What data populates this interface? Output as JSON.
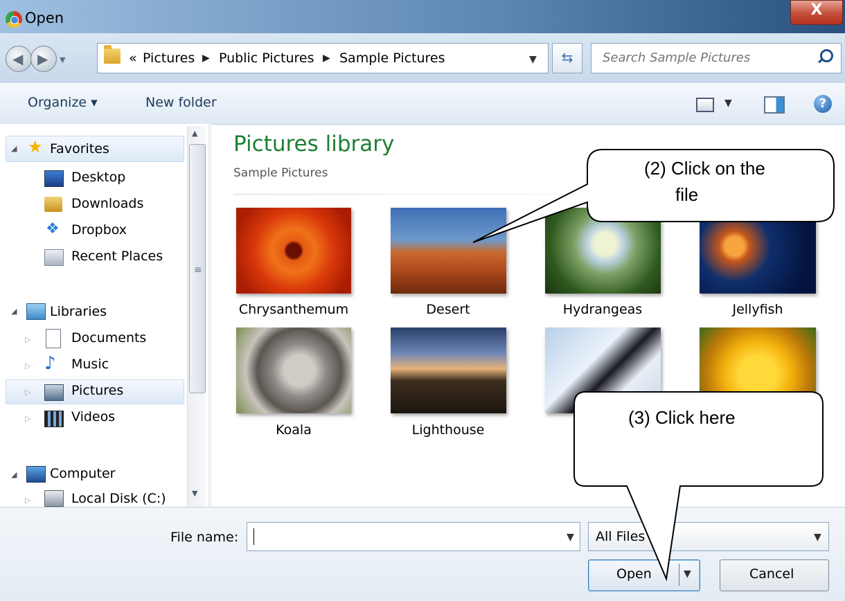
{
  "window": {
    "title": "Open",
    "close_label": "X"
  },
  "address": {
    "overflow": "«",
    "breadcrumbs": [
      "Pictures",
      "Public Pictures",
      "Sample Pictures"
    ],
    "separator": "▶",
    "search_placeholder": "Search Sample Pictures"
  },
  "toolbar": {
    "organize": "Organize ▾",
    "new_folder": "New folder"
  },
  "nav": {
    "favorites": "Favorites",
    "favorites_items": [
      "Desktop",
      "Downloads",
      "Dropbox",
      "Recent Places"
    ],
    "libraries": "Libraries",
    "library_items": [
      "Documents",
      "Music",
      "Pictures",
      "Videos"
    ],
    "computer": "Computer",
    "computer_items": [
      "Local Disk (C:)"
    ],
    "selected": "Pictures"
  },
  "content": {
    "title": "Pictures library",
    "subtitle": "Sample Pictures",
    "files": [
      "Chrysanthemum",
      "Desert",
      "Hydrangeas",
      "Jellyfish",
      "Koala",
      "Lighthouse"
    ]
  },
  "bottom": {
    "file_name_label": "File name:",
    "file_name_value": "",
    "filter": "All Files",
    "open": "Open",
    "cancel": "Cancel"
  },
  "callouts": {
    "step2_line1": "(2) Click   on   the",
    "step2_line2": "file",
    "step3": "(3) Click here"
  },
  "colors": {
    "library_title": "#1e7e34",
    "title_bar_dark": "#29507f",
    "close_button": "#c34e3a"
  }
}
